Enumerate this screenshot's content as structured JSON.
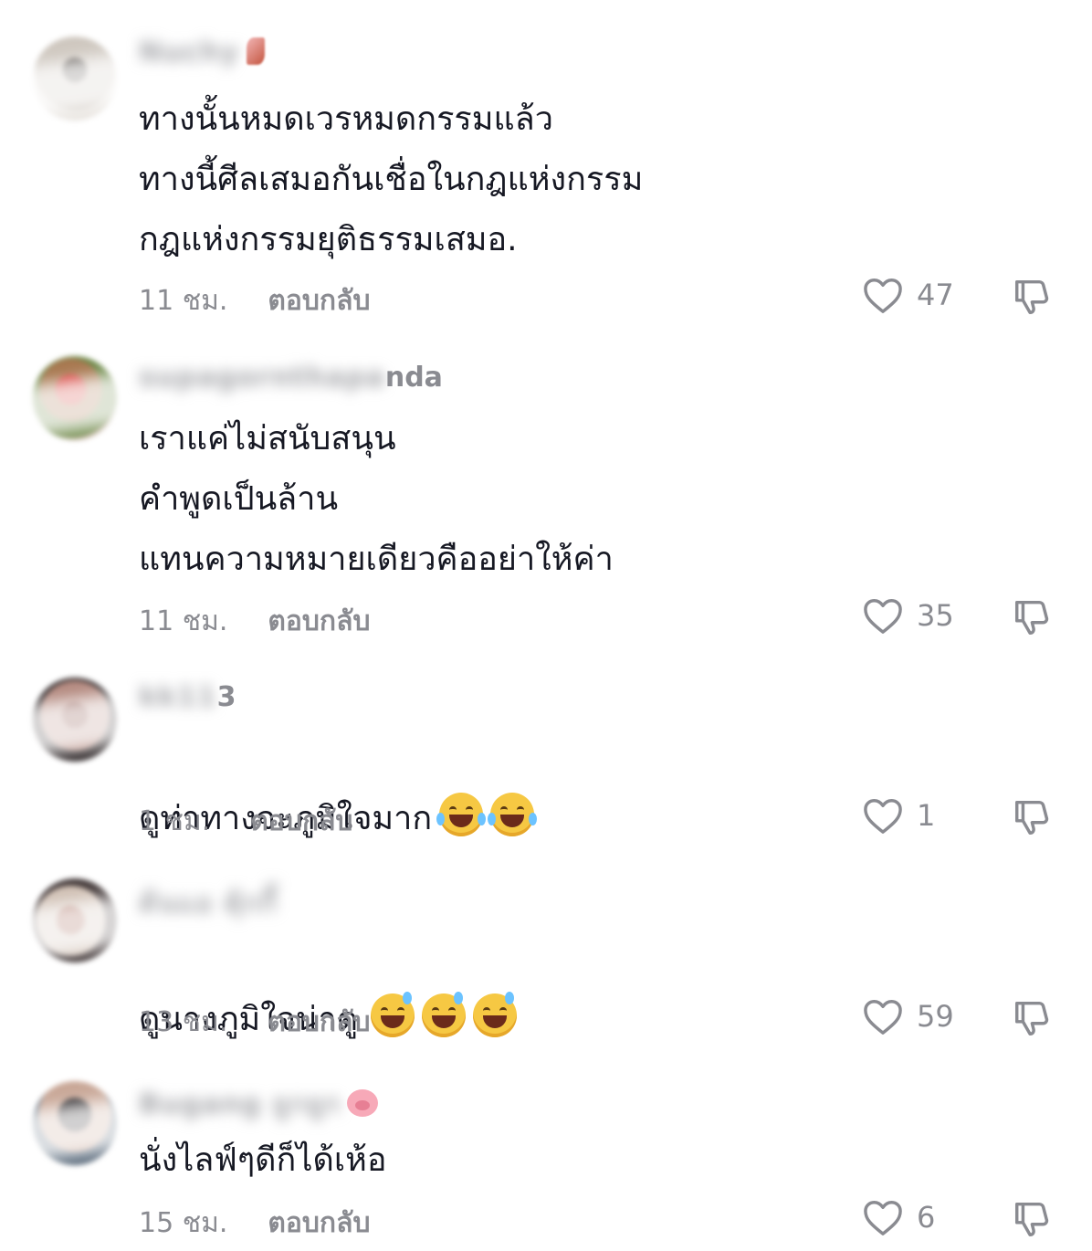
{
  "comments": [
    {
      "username_hidden": "Nuchy",
      "username_visible": "",
      "text": "ทางนั้นหมดเวรหมดกรรมแล้ว\nทางนี้ศีลเสมอกันเชื่อในกฎแห่งกรรม\nกฎแห่งกรรมยุติธรรมเสมอ.",
      "time": "11 ชม.",
      "reply": "ตอบกลับ",
      "likes": "47",
      "avatar_color": "#b9b1a8",
      "emojis": []
    },
    {
      "username_hidden": "supagornthapa",
      "username_visible": "nda",
      "text": "เราแค่ไม่สนับสนุน\nคำพูดเป็นล้าน\nแทนความหมายเดียวคืออย่าให้ค่า",
      "time": "11 ชม.",
      "reply": "ตอบกลับ",
      "likes": "35",
      "avatar_color": "#b96a5c",
      "emojis": []
    },
    {
      "username_hidden": "kk11",
      "username_visible": "3",
      "text": "ดูท่าทางจะภูมิใจมาก",
      "time": "1 ชม.",
      "reply": "ตอบกลับ",
      "likes": "1",
      "avatar_color": "#8f6e64",
      "emojis": [
        "face-with-tears-of-joy",
        "face-with-tears-of-joy"
      ]
    },
    {
      "username_hidden": "ต้นแอ คุ้กกี้",
      "username_visible": "",
      "text": "ดูนางภูมิใจน่าดู",
      "time": "13 ชม.",
      "reply": "ตอบกลับ",
      "likes": "59",
      "avatar_color": "#9a7a6c",
      "emojis": [
        "grinning-face-with-sweat",
        "grinning-face-with-sweat",
        "grinning-face-with-sweat"
      ]
    },
    {
      "username_hidden": "Bugang ยูกยูก",
      "username_visible": "",
      "text": "นั่งไลฟ์ๆดีก็ได้เห้อ",
      "time": "15 ชม.",
      "reply": "ตอบกลับ",
      "likes": "6",
      "avatar_color": "#6c6e78",
      "emojis": []
    }
  ],
  "icons": {
    "like": "heart-outline-icon",
    "dislike": "thumbs-down-outline-icon",
    "username_badge_pig": "pig-face-emoji",
    "username_badge_guitar": "guitar-emoji"
  },
  "colors": {
    "text": "#161823",
    "muted": "#8a8b91",
    "background": "#ffffff"
  }
}
